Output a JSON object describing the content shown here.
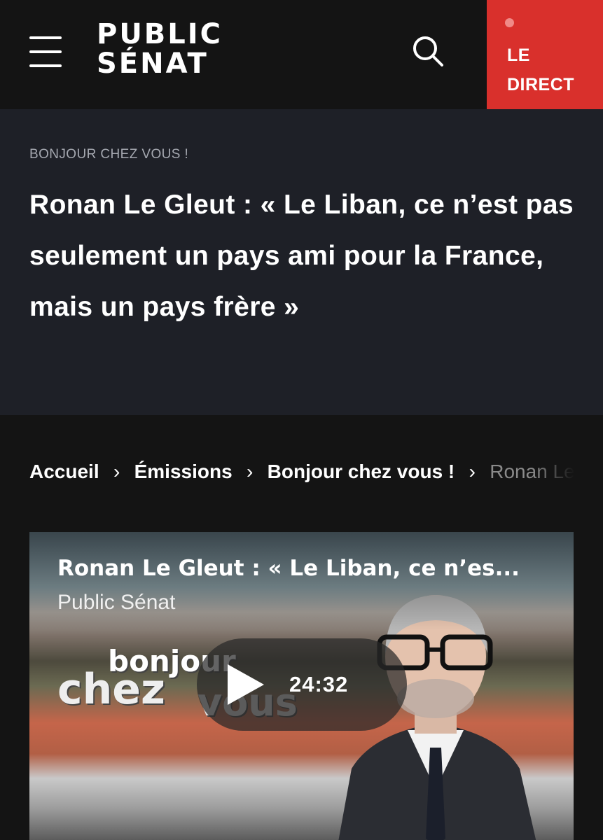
{
  "header": {
    "logo_line1": "PUBLIC",
    "logo_line2": "SÉNAT",
    "live_label_line1": "LE",
    "live_label_line2": "DIRECT"
  },
  "article": {
    "kicker": "BONJOUR CHEZ VOUS !",
    "title": "Ronan Le Gleut : « Le Liban, ce n’est pas seulement un pays ami pour la France, mais un pays frère »"
  },
  "breadcrumb": {
    "items": [
      "Accueil",
      "Émissions",
      "Bonjour chez vous !"
    ],
    "current": "Ronan Le Gleut : « Le Liban, ce n’est pas seulement un pays ami pour la France, mais un pays frère »",
    "separator": "›"
  },
  "video": {
    "title": "Ronan Le Gleut : « Le Liban, ce n’es...",
    "channel": "Public Sénat",
    "duration": "24:32",
    "show_logo_line1": "bonjour",
    "show_logo_line2": "chez",
    "show_logo_line3": "vous"
  },
  "colors": {
    "header_bg": "#141414",
    "hero_bg": "#1e2027",
    "live_red": "#d9302c",
    "kicker_gray": "#a5a8b0"
  },
  "icons": [
    "menu-icon",
    "search-icon",
    "live-dot-icon",
    "play-icon",
    "chevron-right-icon"
  ]
}
